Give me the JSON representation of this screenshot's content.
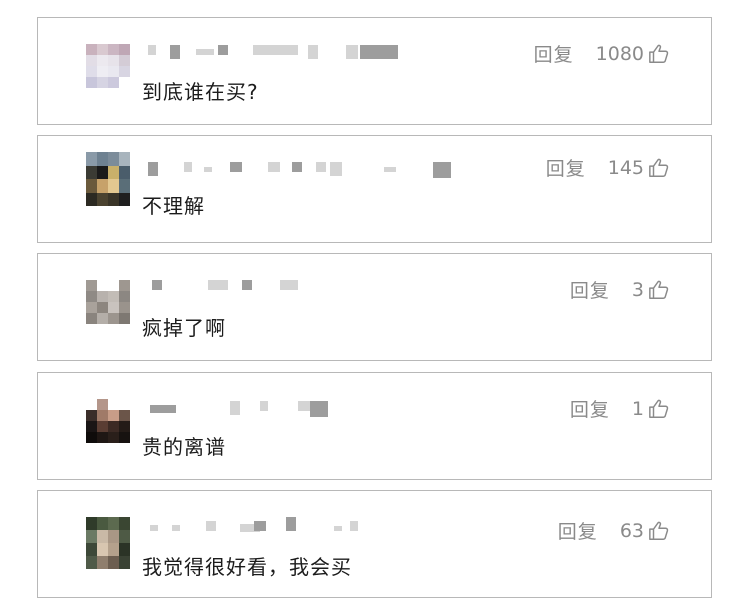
{
  "comments": [
    {
      "text": "到底谁在买?",
      "reply_label": "回复",
      "likes": "1080",
      "like_icon": "thumbs-up-icon"
    },
    {
      "text": "不理解",
      "reply_label": "回复",
      "likes": "145",
      "like_icon": "thumbs-up-icon"
    },
    {
      "text": "疯掉了啊",
      "reply_label": "回复",
      "likes": "3",
      "like_icon": "thumbs-up-icon"
    },
    {
      "text": "贵的离谱",
      "reply_label": "回复",
      "likes": "1",
      "like_icon": "thumbs-up-icon"
    },
    {
      "text": "我觉得很好看，我会买",
      "reply_label": "回复",
      "likes": "63",
      "like_icon": "thumbs-up-icon"
    }
  ],
  "colors": {
    "border": "#b8b8b8",
    "text": "#1c1c1c",
    "muted": "#8a8a8a",
    "background": "#ffffff"
  }
}
